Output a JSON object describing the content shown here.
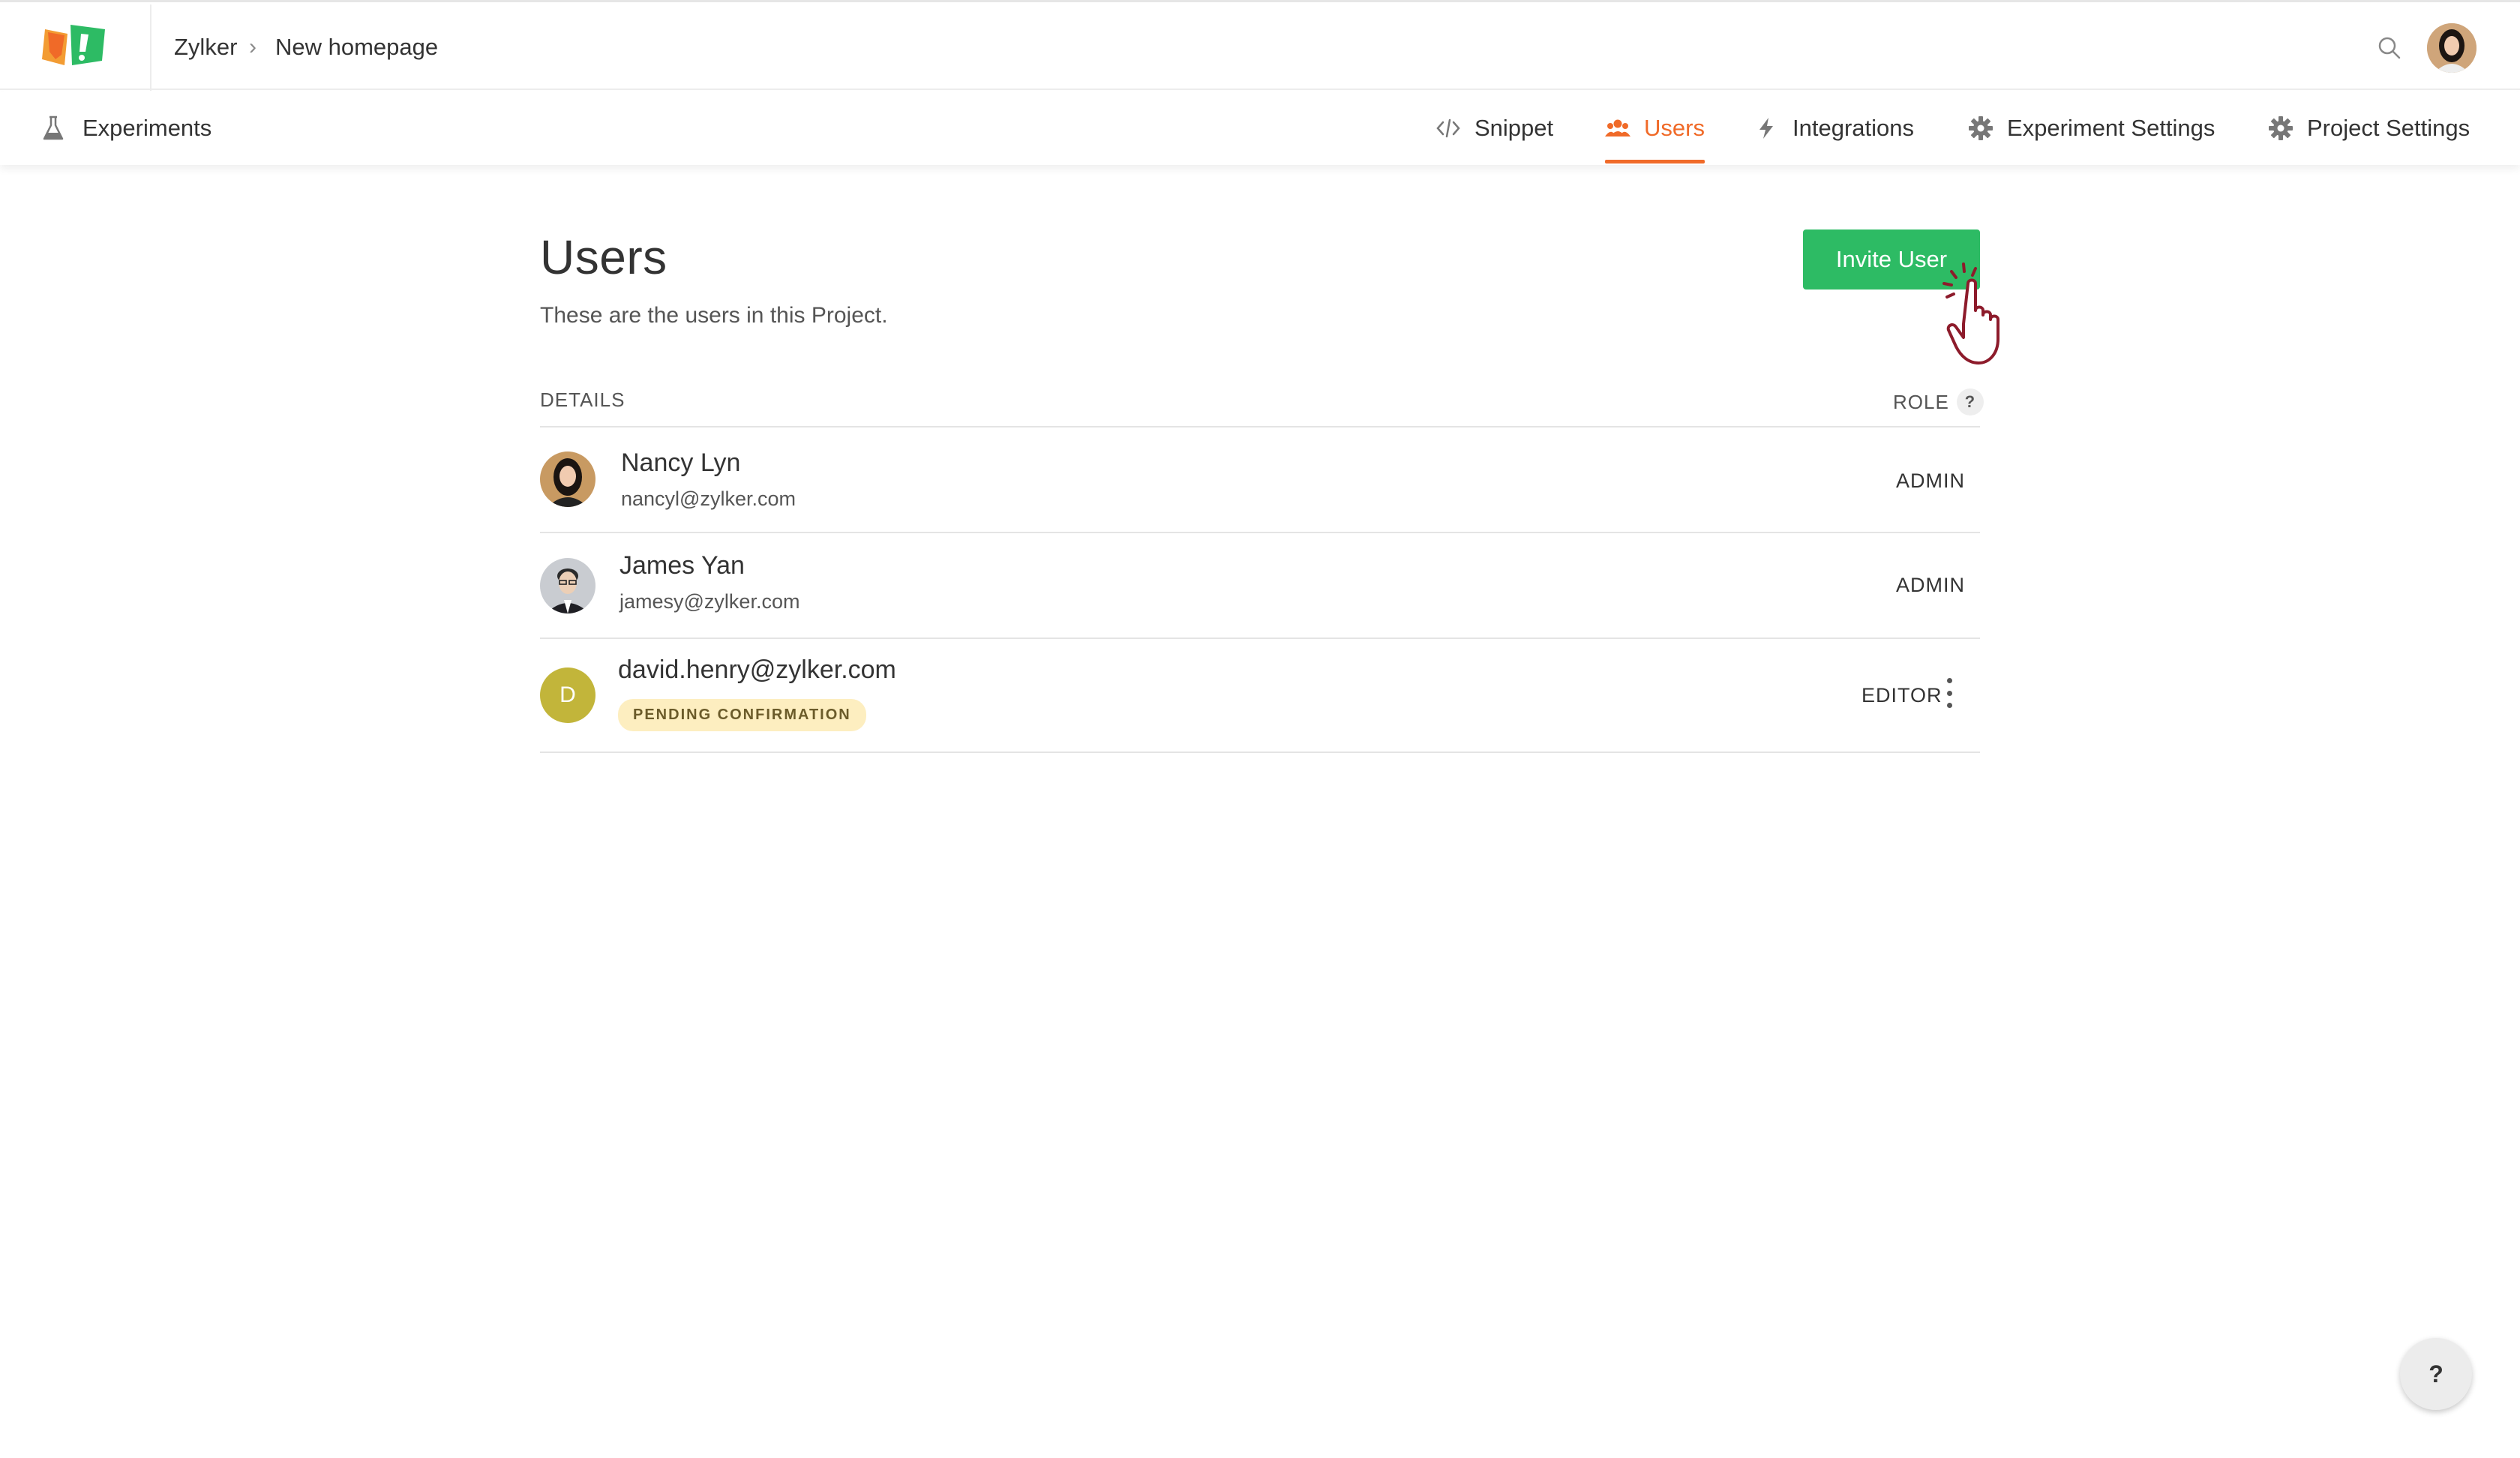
{
  "header": {
    "breadcrumb_root": "Zylker",
    "breadcrumb_separator": "›",
    "breadcrumb_current": "New homepage",
    "logo_icon": "zylker-pageflag-logo",
    "search_icon": "search-icon",
    "avatar_icon": "user-avatar"
  },
  "nav": {
    "left_label": "Experiments",
    "tabs": [
      {
        "label": "Snippet",
        "icon": "code-icon"
      },
      {
        "label": "Users",
        "icon": "users-icon",
        "active": true
      },
      {
        "label": "Integrations",
        "icon": "lightning-icon"
      },
      {
        "label": "Experiment Settings",
        "icon": "gear-icon"
      },
      {
        "label": "Project Settings",
        "icon": "gear-icon"
      }
    ]
  },
  "main": {
    "title": "Users",
    "description": "These are the users in this Project.",
    "invite_label": "Invite User",
    "columns": {
      "details": "DETAILS",
      "role": "ROLE",
      "role_help": "?"
    },
    "users": [
      {
        "name": "Nancy Lyn",
        "email": "nancyl@zylker.com",
        "role": "ADMIN"
      },
      {
        "name": "James Yan",
        "email": "jamesy@zylker.com",
        "role": "ADMIN"
      },
      {
        "name": "david.henry@zylker.com",
        "initial": "D",
        "badge": "PENDING CONFIRMATION",
        "role": "EDITOR"
      }
    ]
  },
  "help_fab": "?",
  "colors": {
    "accent": "#f06a28",
    "invite_green": "#2dbb64",
    "pending_badge_bg": "#fdeec0",
    "letter_avatar": "#c2b53a"
  }
}
